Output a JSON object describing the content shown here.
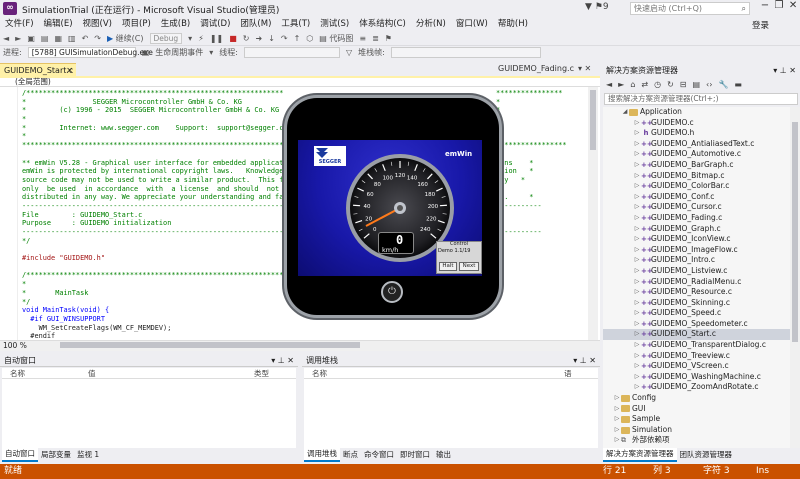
{
  "window": {
    "title": "SimulationTrial (正在运行) - Microsoft Visual Studio(管理员)",
    "notification_count": "9",
    "quick_launch_placeholder": "快速启动 (Ctrl+Q)",
    "login": "登录",
    "window_controls": [
      "−",
      "❐",
      "✕"
    ]
  },
  "menu": [
    "文件(F)",
    "编辑(E)",
    "视图(V)",
    "项目(P)",
    "生成(B)",
    "调试(D)",
    "团队(M)",
    "工具(T)",
    "测试(S)",
    "体系结构(C)",
    "分析(N)",
    "窗口(W)",
    "帮助(H)"
  ],
  "toolbar1": {
    "continue_label": "继续(C)",
    "config_combo": "Debug",
    "code_map_label": "代码图"
  },
  "toolbar2": {
    "process_label": "进程:",
    "process_value": "[5788] GUISimulationDebug.exe",
    "lifecycle_label": "生命周期事件",
    "thread_label": "线程:",
    "stack_label": "堆栈帧:"
  },
  "editor": {
    "active_tab": "GUIDEMO_Start.c",
    "other_tab": "GUIDEMO_Fading.c",
    "scope": "(全局范围)",
    "zoom": "100 %",
    "code_lines": [
      {
        "cls": "c-comment",
        "text": "/*********************************************************************"
      },
      {
        "cls": "c-comment",
        "text": "*                SEGGER Microcontroller GmbH & Co. KG"
      },
      {
        "cls": "c-comment",
        "text": "*        (c) 1996 - 2015  SEGGER Microcontroller GmbH & Co. KG"
      },
      {
        "cls": "c-comment",
        "text": "*"
      },
      {
        "cls": "c-comment",
        "text": "*        Internet: www.segger.com    Support:  support@segger.com"
      },
      {
        "cls": "c-comment",
        "text": "*"
      },
      {
        "cls": "c-comment",
        "text": "**********************************************************************"
      },
      {
        "cls": "c-comment",
        "text": ""
      },
      {
        "cls": "c-comment",
        "text": "** emWin V5.28 - Graphical user interface for embedded applications"
      },
      {
        "cls": "c-comment",
        "text": "emWin is protected by international copyright laws.   Knowledge of"
      },
      {
        "cls": "c-comment",
        "text": "source code may not be used to write a similar product.  This file"
      },
      {
        "cls": "c-comment",
        "text": "only  be used  in accordance  with  a license  and should  not be"
      },
      {
        "cls": "c-comment",
        "text": "distributed in any way. We appreciate your understanding and fairne"
      },
      {
        "cls": "c-comment",
        "text": "----------------------------------------------------------------------"
      },
      {
        "cls": "c-comment",
        "text": "File        : GUIDEMO_Start.c"
      },
      {
        "cls": "c-comment",
        "text": "Purpose     : GUIDEMO initialization"
      },
      {
        "cls": "c-comment",
        "text": "----------------------------------------------------------------------"
      },
      {
        "cls": "c-comment",
        "text": "*/"
      },
      {
        "cls": "c-dark",
        "text": ""
      },
      {
        "cls": "c-str",
        "text": "#include \"GUIDEMO.h\""
      },
      {
        "cls": "c-dark",
        "text": ""
      },
      {
        "cls": "c-comment",
        "text": "/*********************************************************************"
      },
      {
        "cls": "c-comment",
        "text": "*"
      },
      {
        "cls": "c-comment",
        "text": "*       MainTask"
      },
      {
        "cls": "c-comment",
        "text": "*/"
      },
      {
        "cls": "c-kw",
        "text": "void MainTask(void) {"
      },
      {
        "cls": "c-kw",
        "text": "  #if GUI_WINSUPPORT"
      },
      {
        "cls": "c-dark",
        "text": "    WM_SetCreateFlags(WM_CF_MEMDEV);"
      },
      {
        "cls": "c-dark",
        "text": "  #endif"
      }
    ],
    "code_right_lines": [
      "****************",
      "*",
      "*",
      "*",
      "*",
      "*",
      "*****************",
      "",
      "ions    *",
      "ation   *",
      "may   *",
      "*",
      "ss.     *",
      "-----------",
      "",
      "",
      "-----------"
    ]
  },
  "simulation": {
    "brand": "SEGGER",
    "product": "emWin",
    "speed_value": "0",
    "speed_unit": "km/h",
    "gauge_ticks": [
      "0",
      "20",
      "40",
      "60",
      "80",
      "100",
      "120",
      "140",
      "160",
      "180",
      "200",
      "220",
      "240"
    ],
    "control_title": "Control",
    "control_demo": "Demo 1.1/19",
    "halt_label": "Halt",
    "next_label": "Next",
    "power_icon": "⏻"
  },
  "autos_panel": {
    "title": "自动窗口",
    "columns": [
      "名称",
      "值",
      "类型"
    ],
    "tabs": [
      "自动窗口",
      "局部变量",
      "监视 1"
    ]
  },
  "callstack_panel": {
    "title": "调用堆栈",
    "columns": [
      "名称",
      "语"
    ],
    "tabs": [
      "调用堆栈",
      "断点",
      "命令窗口",
      "即时窗口",
      "输出"
    ]
  },
  "solution_explorer": {
    "title": "解决方案资源管理器",
    "search_placeholder": "搜索解决方案资源管理器(Ctrl+;)",
    "items": [
      {
        "type": "folder",
        "label": "Application",
        "indent": 18,
        "open": true
      },
      {
        "type": "cpp",
        "label": "GUIDEMO.c",
        "indent": 30
      },
      {
        "type": "h",
        "label": "GUIDEMO.h",
        "indent": 30
      },
      {
        "type": "cpp",
        "label": "GUIDEMO_AntialiasedText.c",
        "indent": 30
      },
      {
        "type": "cpp",
        "label": "GUIDEMO_Automotive.c",
        "indent": 30
      },
      {
        "type": "cpp",
        "label": "GUIDEMO_BarGraph.c",
        "indent": 30
      },
      {
        "type": "cpp",
        "label": "GUIDEMO_Bitmap.c",
        "indent": 30
      },
      {
        "type": "cpp",
        "label": "GUIDEMO_ColorBar.c",
        "indent": 30
      },
      {
        "type": "cpp",
        "label": "GUIDEMO_Conf.c",
        "indent": 30
      },
      {
        "type": "cpp",
        "label": "GUIDEMO_Cursor.c",
        "indent": 30
      },
      {
        "type": "cpp",
        "label": "GUIDEMO_Fading.c",
        "indent": 30
      },
      {
        "type": "cpp",
        "label": "GUIDEMO_Graph.c",
        "indent": 30
      },
      {
        "type": "cpp",
        "label": "GUIDEMO_IconView.c",
        "indent": 30
      },
      {
        "type": "cpp",
        "label": "GUIDEMO_ImageFlow.c",
        "indent": 30
      },
      {
        "type": "cpp",
        "label": "GUIDEMO_Intro.c",
        "indent": 30
      },
      {
        "type": "cpp",
        "label": "GUIDEMO_Listview.c",
        "indent": 30
      },
      {
        "type": "cpp",
        "label": "GUIDEMO_RadialMenu.c",
        "indent": 30
      },
      {
        "type": "cpp",
        "label": "GUIDEMO_Resource.c",
        "indent": 30
      },
      {
        "type": "cpp",
        "label": "GUIDEMO_Skinning.c",
        "indent": 30
      },
      {
        "type": "cpp",
        "label": "GUIDEMO_Speed.c",
        "indent": 30
      },
      {
        "type": "cpp",
        "label": "GUIDEMO_Speedometer.c",
        "indent": 30
      },
      {
        "type": "cpp",
        "label": "GUIDEMO_Start.c",
        "indent": 30,
        "selected": true
      },
      {
        "type": "cpp",
        "label": "GUIDEMO_TransparentDialog.c",
        "indent": 30
      },
      {
        "type": "cpp",
        "label": "GUIDEMO_Treeview.c",
        "indent": 30
      },
      {
        "type": "cpp",
        "label": "GUIDEMO_VScreen.c",
        "indent": 30
      },
      {
        "type": "cpp",
        "label": "GUIDEMO_WashingMachine.c",
        "indent": 30
      },
      {
        "type": "cpp",
        "label": "GUIDEMO_ZoomAndRotate.c",
        "indent": 30
      },
      {
        "type": "folder",
        "label": "Config",
        "indent": 10,
        "open": false
      },
      {
        "type": "folder",
        "label": "GUI",
        "indent": 10,
        "open": false
      },
      {
        "type": "folder",
        "label": "Sample",
        "indent": 10,
        "open": false
      },
      {
        "type": "folder",
        "label": "Simulation",
        "indent": 10,
        "open": false
      },
      {
        "type": "link",
        "label": "外部依赖项",
        "indent": 10,
        "open": false
      }
    ],
    "tabs": [
      "解决方案资源管理器",
      "团队资源管理器"
    ]
  },
  "status": {
    "ready": "就绪",
    "line": "行 21",
    "col": "列 3",
    "char": "字符 3",
    "ins": "Ins",
    "bar_color": "#ca5100"
  }
}
